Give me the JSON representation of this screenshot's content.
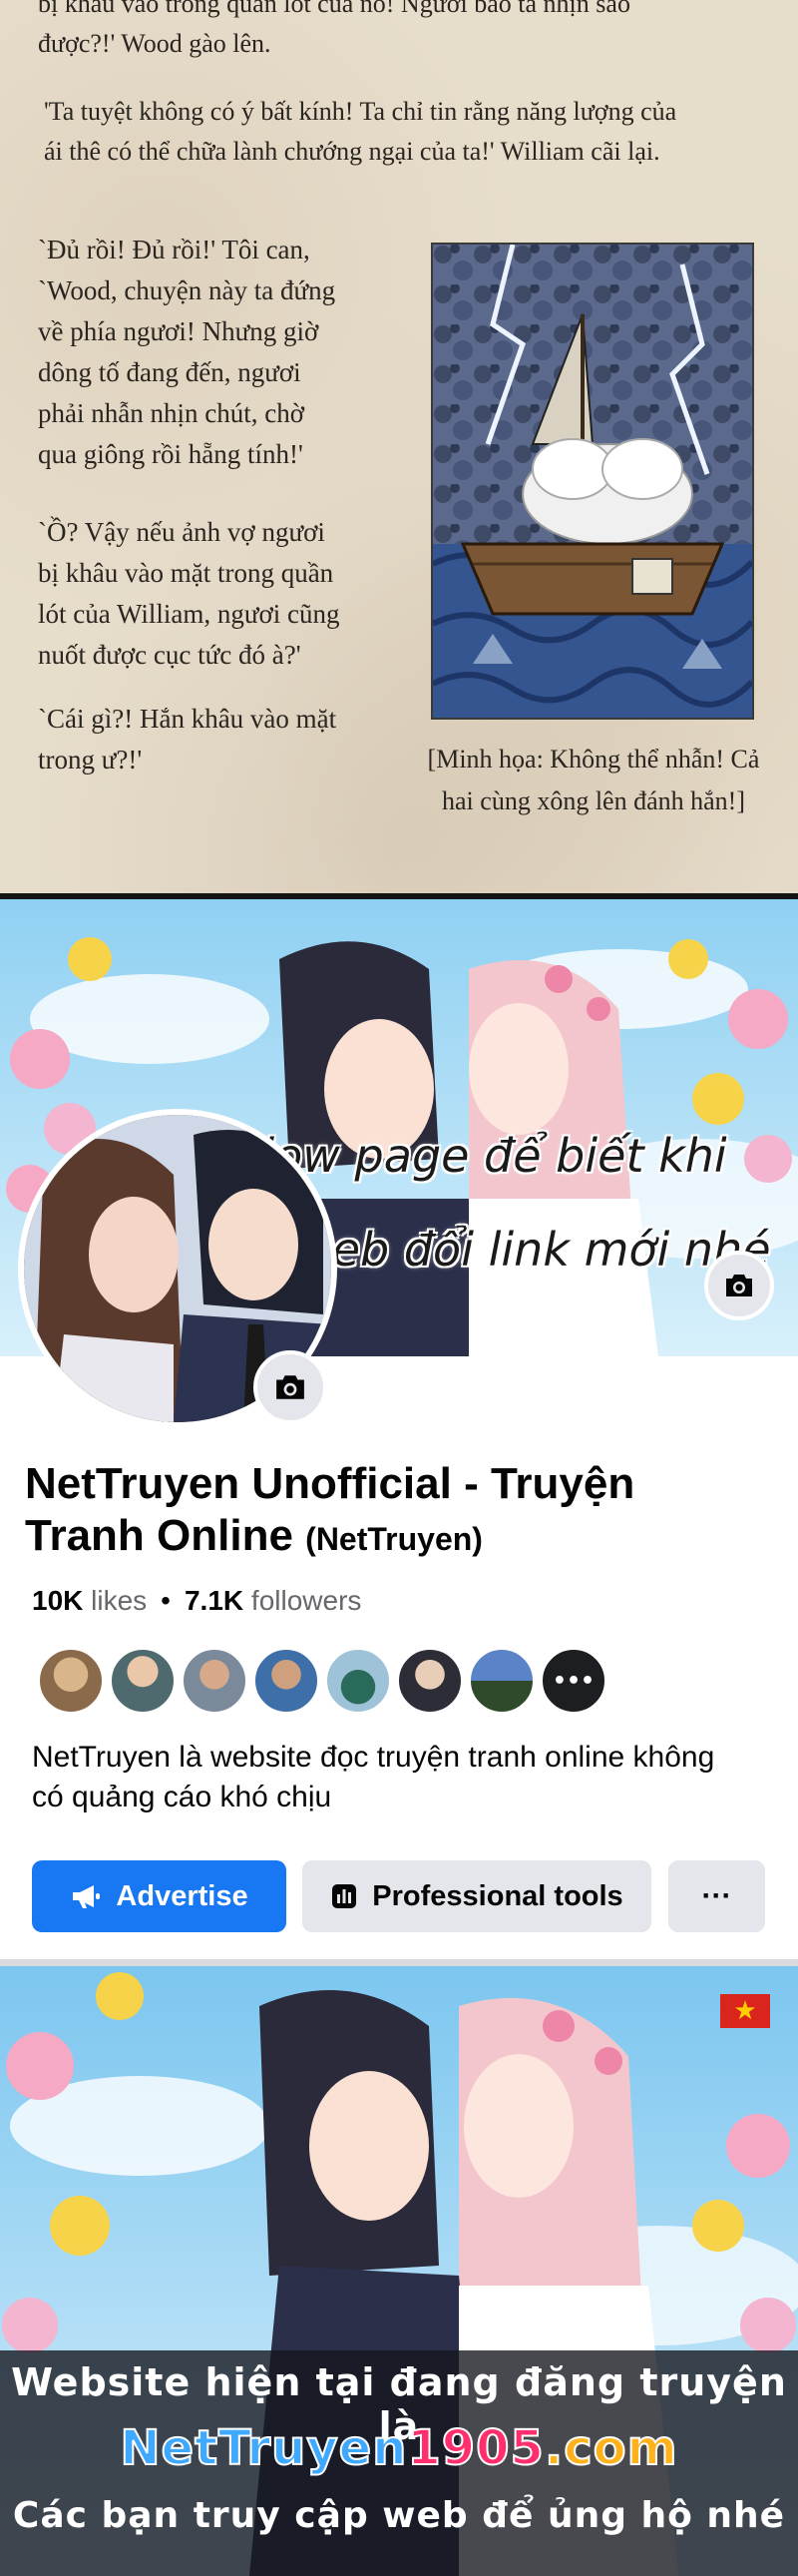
{
  "manga": {
    "line_top": "bị khâu vào trong quần lót của nó! Người bảo ta nhịn sao được?!' Wood gào lên.",
    "line_top_a": "bị khâu vào trong quần lót của nó! Người bảo ta nhịn sao",
    "line_top_b": "được?!' Wood gào lên.",
    "william_a": "'Ta tuyệt không có ý bất kính! Ta chỉ tin rằng năng lượng của",
    "william_b": "ái thê có thể chữa lành chướng ngại của ta!' William cãi lại.",
    "col1": [
      "`Đủ rồi! Đủ rồi!'  Tôi can,",
      "`Wood, chuyện này ta đứng",
      "về phía ngươi! Nhưng giờ",
      "dông tố đang đến, ngươi",
      "phải nhẫn nhịn chút, chờ",
      "qua giông rồi hẵng tính!'"
    ],
    "col2": [
      "`Ồ? Vậy nếu ảnh vợ ngươi",
      "bị khâu vào mặt trong quần",
      "lót của William, ngươi cũng",
      "nuốt được cục tức đó à?'"
    ],
    "col3": [
      "`Cái gì?! Hắn khâu vào mặt",
      "trong ư?!'"
    ],
    "caption_a": "[Minh họa: Không thể nhẫn! Cả",
    "caption_b": "hai cùng xông lên đánh hắn!]"
  },
  "facebook": {
    "cover_text_line1": "Follow page để biết khi",
    "cover_text_line2": "nào web đổi link mới nhé",
    "page_name": "NetTruyen Unofficial - Truyện Tranh Online",
    "page_handle": "(NetTruyen)",
    "likes_count": "10K",
    "likes_label": "likes",
    "followers_count": "7.1K",
    "followers_label": "followers",
    "description": "NetTruyen là website đọc truyện tranh online không có quảng cáo khó chịu",
    "advertise_label": "Advertise",
    "professional_tools_label": "Professional tools",
    "more_label": "···",
    "icons": [
      "camera-icon",
      "megaphone-icon",
      "bar-chart-icon",
      "more-icon"
    ]
  },
  "banner": {
    "line1": "Website hiện tại đang đăng truyện là",
    "url_part1": "NetTruyen",
    "url_part2": "1905",
    "url_part3": ".com",
    "line3": "Các bạn truy cập web để ủng hộ nhé",
    "flag_star": "★"
  }
}
